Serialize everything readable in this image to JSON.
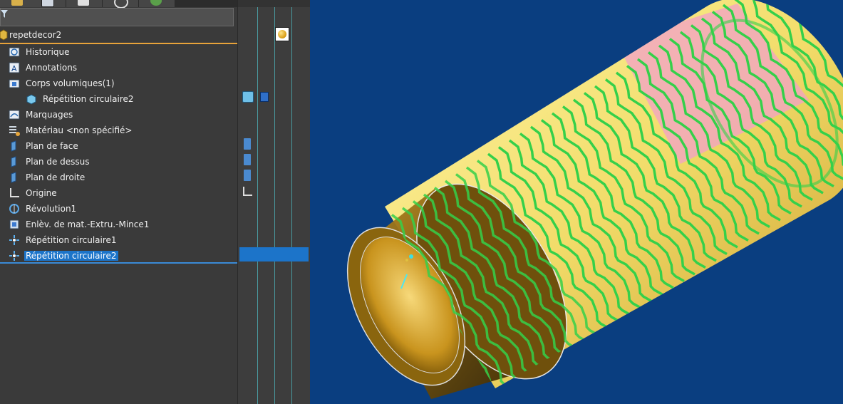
{
  "app": {
    "document_name": "repetdecor2"
  },
  "tree": {
    "root": {
      "label": "repetdecor2",
      "icon": "part-icon"
    },
    "items": [
      {
        "label": "Historique",
        "icon": "history-icon",
        "indent": 0
      },
      {
        "label": "Annotations",
        "icon": "annotations-icon",
        "indent": 0
      },
      {
        "label": "Corps volumiques(1)",
        "icon": "solid-bodies-folder-icon",
        "indent": 0
      },
      {
        "label": "Répétition circulaire2",
        "icon": "solid-body-icon",
        "indent": 1
      },
      {
        "label": "Marquages",
        "icon": "markups-icon",
        "indent": 0
      },
      {
        "label": "Matériau <non spécifié>",
        "icon": "material-icon",
        "indent": 0
      },
      {
        "label": "Plan de face",
        "icon": "plane-icon",
        "indent": 0
      },
      {
        "label": "Plan de dessus",
        "icon": "plane-icon",
        "indent": 0
      },
      {
        "label": "Plan de droite",
        "icon": "plane-icon",
        "indent": 0
      },
      {
        "label": "Origine",
        "icon": "origin-icon",
        "indent": 0
      },
      {
        "label": "Révolution1",
        "icon": "revolve-icon",
        "indent": 0
      },
      {
        "label": "Enlèv. de mat.-Extru.-Mince1",
        "icon": "cut-extrude-icon",
        "indent": 0
      },
      {
        "label": "Répétition circulaire1",
        "icon": "circular-pattern-icon",
        "indent": 0
      },
      {
        "label": "Répétition circulaire2",
        "icon": "circular-pattern-icon",
        "indent": 0,
        "selected": true
      }
    ]
  },
  "colors": {
    "viewport_bg": "#0a3e80",
    "selection": "#1c74c9",
    "root_underline": "#e8a33a",
    "pattern_green": "#35d04a",
    "part_yellow": "#f4e07a",
    "pattern_pink": "#ee8fc0"
  }
}
